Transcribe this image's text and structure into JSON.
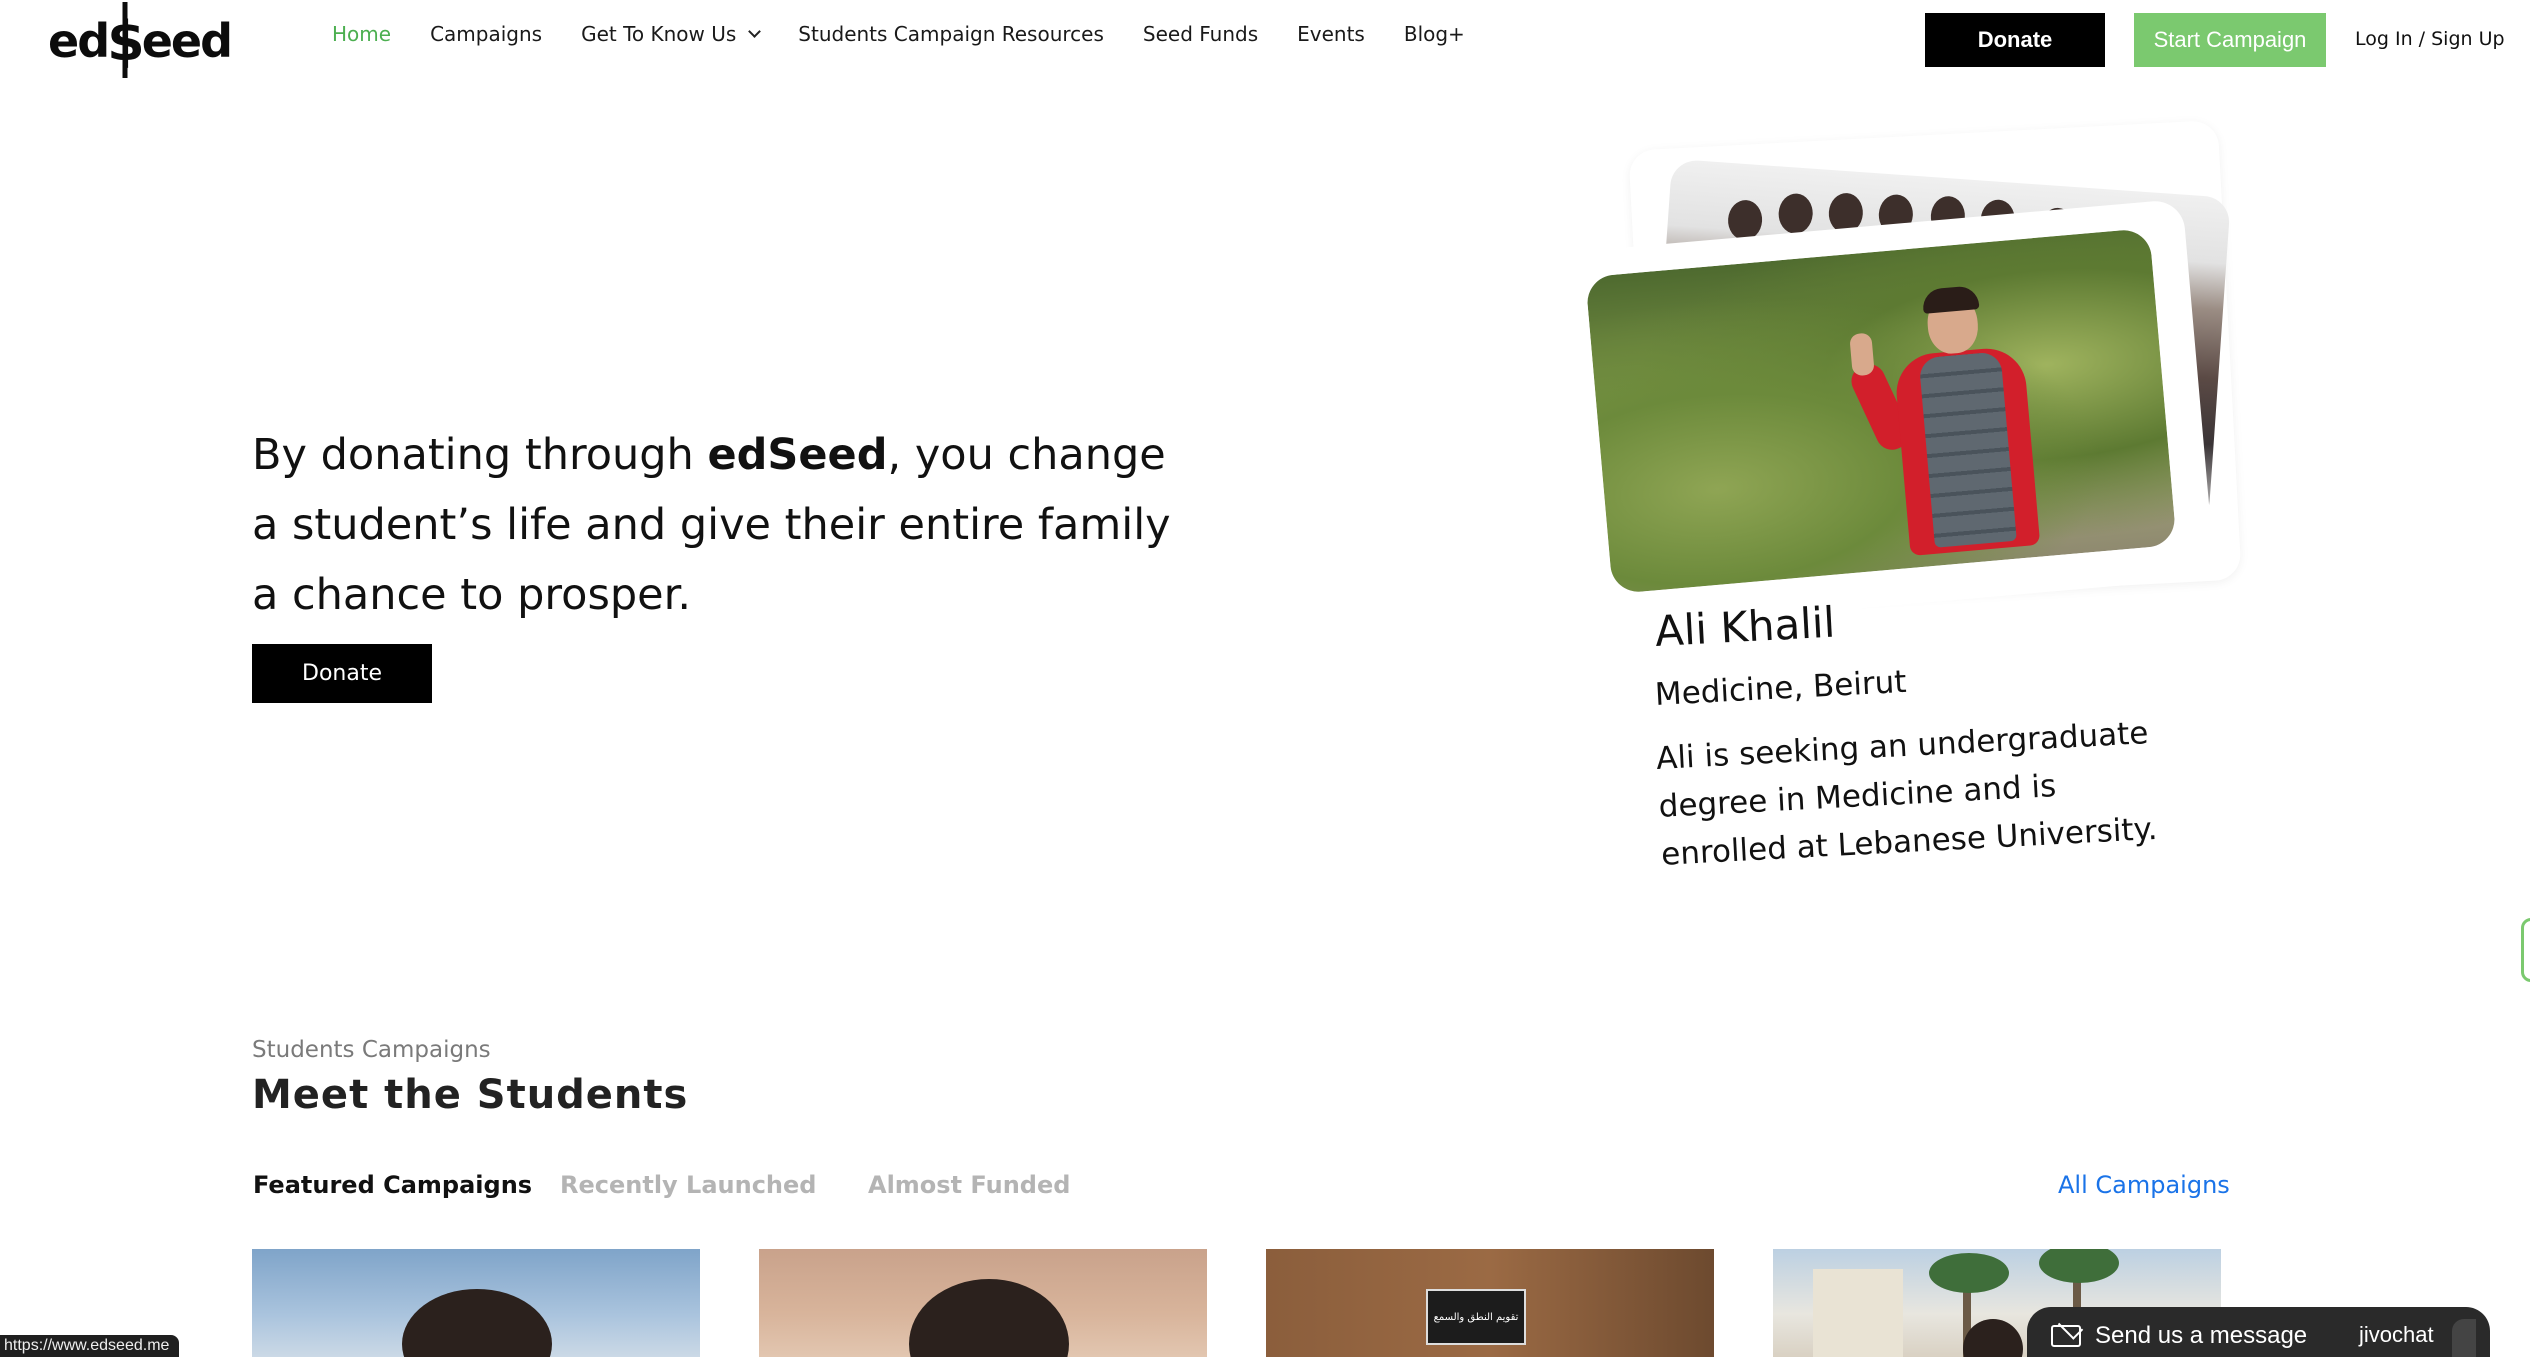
{
  "logo": {
    "text_left": "ed",
    "text_dollar": "$",
    "text_right": "eed"
  },
  "nav": {
    "items": [
      {
        "label": "Home",
        "active": true
      },
      {
        "label": "Campaigns"
      },
      {
        "label": "Get To Know Us",
        "dropdown": true
      },
      {
        "label": "Students Campaign Resources"
      },
      {
        "label": "Seed Funds"
      },
      {
        "label": "Events"
      },
      {
        "label": "Blog+"
      }
    ],
    "donate_label": "Donate",
    "start_campaign_label": "Start Campaign",
    "login_label": "Log In / Sign Up"
  },
  "hero": {
    "text_before": "By donating through ",
    "text_brand": "edSeed",
    "text_after": ", you change a student’s life and give their entire family a chance to prosper.",
    "donate_label": "Donate"
  },
  "profile": {
    "name": "Ali Khalil",
    "field": "Medicine, Beirut",
    "description": "Ali is seeking an undergraduate degree in Medicine and is enrolled at Lebanese University."
  },
  "students": {
    "eyebrow": "Students Campaigns",
    "title": "Meet the Students",
    "tabs": [
      {
        "label": "Featured Campaigns",
        "active": true
      },
      {
        "label": "Recently Launched"
      },
      {
        "label": "Almost Funded"
      }
    ],
    "all_campaigns_label": "All Campaigns",
    "card3_sign_text": "تقويم النطق والسمع"
  },
  "status_bar": {
    "url": "https://www.edseed.me"
  },
  "chat": {
    "label": "Send us a message",
    "brand": "jivochat"
  },
  "colors": {
    "accent_green": "#7bc96f",
    "active_nav": "#4caf50",
    "link_blue": "#1a73e8",
    "black": "#000000"
  }
}
